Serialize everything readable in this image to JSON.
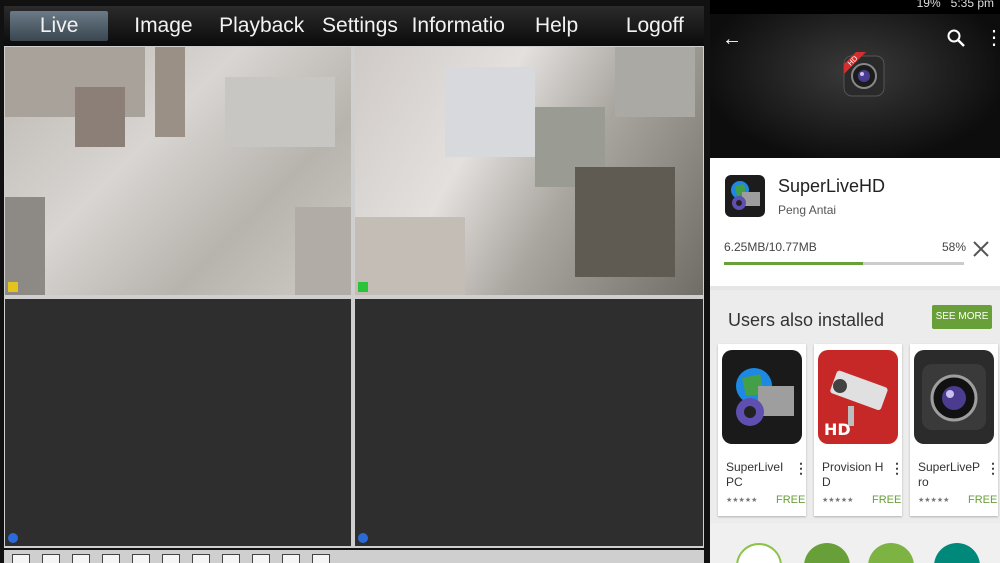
{
  "dvr": {
    "tabs": [
      "Live",
      "Image",
      "Playback",
      "Settings",
      "Informatio",
      "Help",
      "Logoff"
    ],
    "active_tab": "Live",
    "cameras": [
      {
        "status": "feed",
        "status_color": "#e3c31d",
        "selected": true
      },
      {
        "status": "feed",
        "status_color": "#29c43a",
        "selected": false
      },
      {
        "status": "no-signal",
        "status_color": "#2b6ad8",
        "selected": false
      },
      {
        "status": "no-signal",
        "status_color": "#2b6ad8",
        "selected": false
      }
    ],
    "toolbar_icons": [
      "layout-1-icon",
      "layout-4-icon",
      "layout-9-icon",
      "layout-16-icon",
      "fullscreen-icon",
      "keyboard-icon",
      "record-icon",
      "snapshot-icon",
      "audio-icon",
      "talk-icon",
      "settings-icon"
    ]
  },
  "phone": {
    "statusbar": {
      "battery": "19%",
      "time": "5:35 pm"
    },
    "header": {
      "back_icon": "arrow-left-icon",
      "search_icon": "search-icon",
      "more_icon": "more-vert-icon",
      "hero_badge": "HD"
    },
    "app": {
      "name": "SuperLiveHD",
      "developer": "Peng Antai",
      "downloaded": "6.25MB/10.77MB",
      "percent": "58%",
      "progress": 0.58
    },
    "also_installed": {
      "title": "Users also installed",
      "see_more": "SEE MORE",
      "apps": [
        {
          "name": "SuperLiveIPC",
          "stars": "★★★★★",
          "price": "FREE"
        },
        {
          "name": "Provision HD",
          "stars": "★★★★★",
          "price": "FREE",
          "badge": "HD"
        },
        {
          "name": "SuperLivePro",
          "stars": "★★★★★",
          "price": "FREE"
        }
      ]
    },
    "accent": "#689f38"
  }
}
